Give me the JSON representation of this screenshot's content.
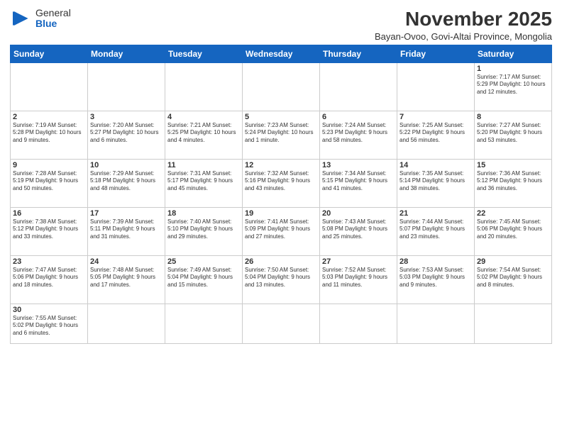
{
  "header": {
    "logo_general": "General",
    "logo_blue": "Blue",
    "month_title": "November 2025",
    "location": "Bayan-Ovoo, Govi-Altai Province, Mongolia"
  },
  "weekdays": [
    "Sunday",
    "Monday",
    "Tuesday",
    "Wednesday",
    "Thursday",
    "Friday",
    "Saturday"
  ],
  "weeks": [
    [
      {
        "day": "",
        "info": ""
      },
      {
        "day": "",
        "info": ""
      },
      {
        "day": "",
        "info": ""
      },
      {
        "day": "",
        "info": ""
      },
      {
        "day": "",
        "info": ""
      },
      {
        "day": "",
        "info": ""
      },
      {
        "day": "1",
        "info": "Sunrise: 7:17 AM\nSunset: 5:29 PM\nDaylight: 10 hours and 12 minutes."
      }
    ],
    [
      {
        "day": "2",
        "info": "Sunrise: 7:19 AM\nSunset: 5:28 PM\nDaylight: 10 hours and 9 minutes."
      },
      {
        "day": "3",
        "info": "Sunrise: 7:20 AM\nSunset: 5:27 PM\nDaylight: 10 hours and 6 minutes."
      },
      {
        "day": "4",
        "info": "Sunrise: 7:21 AM\nSunset: 5:25 PM\nDaylight: 10 hours and 4 minutes."
      },
      {
        "day": "5",
        "info": "Sunrise: 7:23 AM\nSunset: 5:24 PM\nDaylight: 10 hours and 1 minute."
      },
      {
        "day": "6",
        "info": "Sunrise: 7:24 AM\nSunset: 5:23 PM\nDaylight: 9 hours and 58 minutes."
      },
      {
        "day": "7",
        "info": "Sunrise: 7:25 AM\nSunset: 5:22 PM\nDaylight: 9 hours and 56 minutes."
      },
      {
        "day": "8",
        "info": "Sunrise: 7:27 AM\nSunset: 5:20 PM\nDaylight: 9 hours and 53 minutes."
      }
    ],
    [
      {
        "day": "9",
        "info": "Sunrise: 7:28 AM\nSunset: 5:19 PM\nDaylight: 9 hours and 50 minutes."
      },
      {
        "day": "10",
        "info": "Sunrise: 7:29 AM\nSunset: 5:18 PM\nDaylight: 9 hours and 48 minutes."
      },
      {
        "day": "11",
        "info": "Sunrise: 7:31 AM\nSunset: 5:17 PM\nDaylight: 9 hours and 45 minutes."
      },
      {
        "day": "12",
        "info": "Sunrise: 7:32 AM\nSunset: 5:16 PM\nDaylight: 9 hours and 43 minutes."
      },
      {
        "day": "13",
        "info": "Sunrise: 7:34 AM\nSunset: 5:15 PM\nDaylight: 9 hours and 41 minutes."
      },
      {
        "day": "14",
        "info": "Sunrise: 7:35 AM\nSunset: 5:14 PM\nDaylight: 9 hours and 38 minutes."
      },
      {
        "day": "15",
        "info": "Sunrise: 7:36 AM\nSunset: 5:12 PM\nDaylight: 9 hours and 36 minutes."
      }
    ],
    [
      {
        "day": "16",
        "info": "Sunrise: 7:38 AM\nSunset: 5:12 PM\nDaylight: 9 hours and 33 minutes."
      },
      {
        "day": "17",
        "info": "Sunrise: 7:39 AM\nSunset: 5:11 PM\nDaylight: 9 hours and 31 minutes."
      },
      {
        "day": "18",
        "info": "Sunrise: 7:40 AM\nSunset: 5:10 PM\nDaylight: 9 hours and 29 minutes."
      },
      {
        "day": "19",
        "info": "Sunrise: 7:41 AM\nSunset: 5:09 PM\nDaylight: 9 hours and 27 minutes."
      },
      {
        "day": "20",
        "info": "Sunrise: 7:43 AM\nSunset: 5:08 PM\nDaylight: 9 hours and 25 minutes."
      },
      {
        "day": "21",
        "info": "Sunrise: 7:44 AM\nSunset: 5:07 PM\nDaylight: 9 hours and 23 minutes."
      },
      {
        "day": "22",
        "info": "Sunrise: 7:45 AM\nSunset: 5:06 PM\nDaylight: 9 hours and 20 minutes."
      }
    ],
    [
      {
        "day": "23",
        "info": "Sunrise: 7:47 AM\nSunset: 5:06 PM\nDaylight: 9 hours and 18 minutes."
      },
      {
        "day": "24",
        "info": "Sunrise: 7:48 AM\nSunset: 5:05 PM\nDaylight: 9 hours and 17 minutes."
      },
      {
        "day": "25",
        "info": "Sunrise: 7:49 AM\nSunset: 5:04 PM\nDaylight: 9 hours and 15 minutes."
      },
      {
        "day": "26",
        "info": "Sunrise: 7:50 AM\nSunset: 5:04 PM\nDaylight: 9 hours and 13 minutes."
      },
      {
        "day": "27",
        "info": "Sunrise: 7:52 AM\nSunset: 5:03 PM\nDaylight: 9 hours and 11 minutes."
      },
      {
        "day": "28",
        "info": "Sunrise: 7:53 AM\nSunset: 5:03 PM\nDaylight: 9 hours and 9 minutes."
      },
      {
        "day": "29",
        "info": "Sunrise: 7:54 AM\nSunset: 5:02 PM\nDaylight: 9 hours and 8 minutes."
      }
    ],
    [
      {
        "day": "30",
        "info": "Sunrise: 7:55 AM\nSunset: 5:02 PM\nDaylight: 9 hours and 6 minutes."
      },
      {
        "day": "",
        "info": ""
      },
      {
        "day": "",
        "info": ""
      },
      {
        "day": "",
        "info": ""
      },
      {
        "day": "",
        "info": ""
      },
      {
        "day": "",
        "info": ""
      },
      {
        "day": "",
        "info": ""
      }
    ]
  ]
}
